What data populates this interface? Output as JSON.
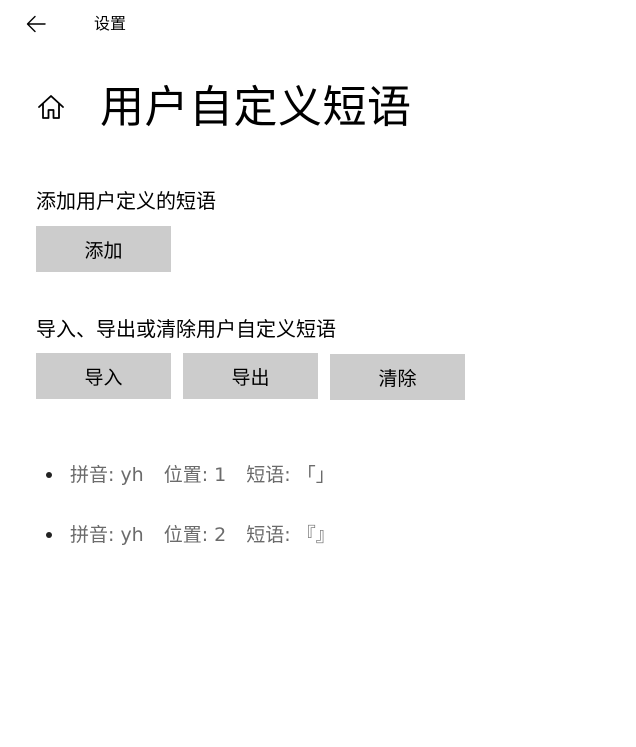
{
  "window": {
    "title": "设置"
  },
  "header": {
    "title": "用户自定义短语"
  },
  "add_section": {
    "label": "添加用户定义的短语",
    "add_button": "添加"
  },
  "manage_section": {
    "label": "导入、导出或清除用户自定义短语",
    "import_button": "导入",
    "export_button": "导出",
    "clear_button": "清除"
  },
  "phrases": [
    {
      "pinyin_label": "拼音: yh",
      "position_label": "位置: 1",
      "phrase_label": "短语: 「」"
    },
    {
      "pinyin_label": "拼音: yh",
      "position_label": "位置: 2",
      "phrase_label": "短语: 『』"
    }
  ],
  "icons": {
    "back": "back-arrow-icon",
    "home": "home-icon"
  }
}
